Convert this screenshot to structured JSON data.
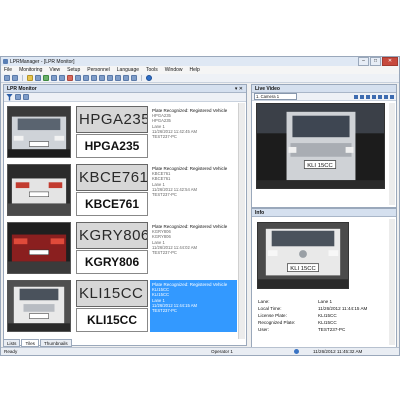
{
  "window": {
    "title": "LPRManager - [LPR Monitor]",
    "min": "–",
    "max": "□",
    "close": "✕"
  },
  "menu": [
    "File",
    "Monitoring",
    "View",
    "Setup",
    "Personnel",
    "Language",
    "Tools",
    "Window",
    "Help"
  ],
  "lpr_monitor": {
    "title": "LPR Monitor",
    "pin": "▾ ✕",
    "records": [
      {
        "plate_image_text": "HPGA235",
        "plate": "HPGA235",
        "status": "Plate Recognized: Registered Vehicle",
        "line2": "HPGA235",
        "line3": "HPGA235",
        "lane": "Lane 1",
        "time": "11/26/2012 11:42:45 AM",
        "pc": "TEST237-PC"
      },
      {
        "plate_image_text": "KBCE761",
        "plate": "KBCE761",
        "status": "Plate Recognized: Registered Vehicle",
        "line2": "KBCE761",
        "line3": "KBCE761",
        "lane": "Lane 1",
        "time": "11/26/2012 11:42:54 AM",
        "pc": "TEST237-PC"
      },
      {
        "plate_image_text": "KGRY806",
        "plate": "KGRY806",
        "status": "Plate Recognized: Registered Vehicle",
        "line2": "KGRY806",
        "line3": "KGRY806",
        "lane": "Lane 1",
        "time": "11/26/2012 11:44:02 AM",
        "pc": "TEST237-PC"
      },
      {
        "plate_image_text": "KLI15CC",
        "plate": "KLI15CC",
        "status": "Plate Recognized: Registered Vehicle",
        "line2": "KLI15CC",
        "line3": "KLI15CC",
        "lane": "Lane 1",
        "time": "11/26/2012 11:44:15 AM",
        "pc": "TEST237-PC",
        "selected": true
      }
    ],
    "tabs": [
      "Lists",
      "Tiles",
      "Thumbnails"
    ],
    "active_tab": "Tiles"
  },
  "live_video": {
    "title": "Live Video",
    "camera": "1. Camera 1",
    "overlay_plate": "KLI 15CC"
  },
  "info": {
    "title": "Info",
    "image_plate": "KLI 15CC",
    "fields": [
      {
        "key": "Lane:",
        "value": "Lane 1"
      },
      {
        "key": "Local Time:",
        "value": "11/26/2012 11:44:15 AM"
      },
      {
        "key": "License Plate:",
        "value": "KLI15CC"
      },
      {
        "key": "Recognized Plate:",
        "value": "KLI15CC"
      },
      {
        "key": "User:",
        "value": "TEST237-PC"
      }
    ]
  },
  "status": {
    "ready": "Ready",
    "operator": "Operator 1",
    "datetime": "11/26/2012 11:45:32 AM"
  },
  "colors": {
    "selection": "#3399ff",
    "header": "#d5e0ef",
    "close": "#c7493d"
  }
}
